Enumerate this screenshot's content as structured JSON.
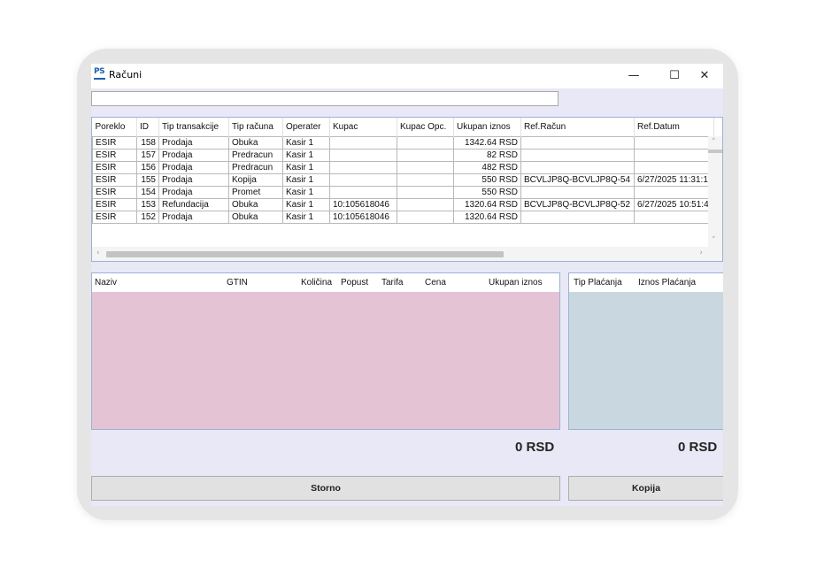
{
  "window": {
    "title": "Računi",
    "minimize_glyph": "—",
    "maximize_glyph": "☐",
    "close_glyph": "✕",
    "icon": "ps-app-icon",
    "icon_text": "PS"
  },
  "search": {
    "value": "",
    "placeholder": ""
  },
  "receipts": {
    "columns": [
      "Poreklo",
      "ID",
      "Tip transakcije",
      "Tip računa",
      "Operater",
      "Kupac",
      "Kupac Opc.",
      "Ukupan iznos",
      "Ref.Račun",
      "Ref.Datum"
    ],
    "rows": [
      [
        "ESIR",
        "158",
        "Prodaja",
        "Obuka",
        "Kasir 1",
        "",
        "",
        "1342.64 RSD",
        "",
        ""
      ],
      [
        "ESIR",
        "157",
        "Prodaja",
        "Predracun",
        "Kasir 1",
        "",
        "",
        "82 RSD",
        "",
        ""
      ],
      [
        "ESIR",
        "156",
        "Prodaja",
        "Predracun",
        "Kasir 1",
        "",
        "",
        "482 RSD",
        "",
        ""
      ],
      [
        "ESIR",
        "155",
        "Prodaja",
        "Kopija",
        "Kasir 1",
        "",
        "",
        "550 RSD",
        "BCVLJP8Q-BCVLJP8Q-54",
        "6/27/2025 11:31:1"
      ],
      [
        "ESIR",
        "154",
        "Prodaja",
        "Promet",
        "Kasir 1",
        "",
        "",
        "550 RSD",
        "",
        ""
      ],
      [
        "ESIR",
        "153",
        "Refundacija",
        "Obuka",
        "Kasir 1",
        "10:105618046",
        "",
        "1320.64 RSD",
        "BCVLJP8Q-BCVLJP8Q-52",
        "6/27/2025 10:51:4"
      ],
      [
        "ESIR",
        "152",
        "Prodaja",
        "Obuka",
        "Kasir 1",
        "10:105618046",
        "",
        "1320.64 RSD",
        "",
        ""
      ]
    ]
  },
  "items": {
    "columns": [
      "Naziv",
      "GTIN",
      "Količina",
      "Popust",
      "Tarifa",
      "Cena",
      "Ukupan iznos"
    ],
    "total": "0 RSD"
  },
  "payments": {
    "columns": [
      "Tip Plaćanja",
      "Iznos Plaćanja"
    ],
    "total": "0 RSD"
  },
  "buttons": {
    "storno": "Storno",
    "kopija": "Kopija"
  },
  "colors": {
    "items_panel": "#e4c3d5",
    "payments_panel": "#c9d8e0",
    "window_bg": "#e8e8f6",
    "grid_border": "#9bb2d6"
  }
}
